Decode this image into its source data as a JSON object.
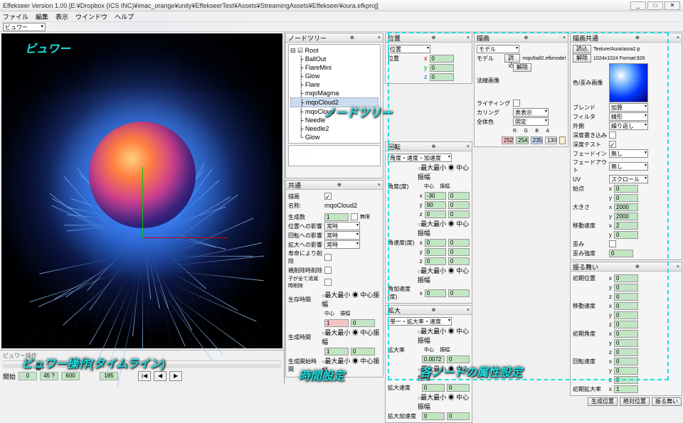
{
  "title": "Effekseer Version 1.00 [E:¥Dropbox (ICS INC)¥imac_orange¥unity¥EffekseerTest¥Assets¥StreamingAssets¥Effekseer¥oura.efkproj]",
  "menu": [
    "ファイル",
    "編集",
    "表示",
    "ウインドウ",
    "ヘルプ"
  ],
  "viewerCombo": "ビュワー",
  "ctrlHdr": "ビュワー操作",
  "playback": {
    "start": "開始",
    "v1": "0",
    "v2": "45 ?",
    "v3": "600",
    "v4": "185"
  },
  "tree": {
    "hdr": "ノードツリー",
    "root": "Root",
    "items": [
      "BallOut",
      "FlareMini",
      "Glow",
      "Flare",
      "mqoMagma",
      "mqoCloud2",
      "mqoCloud",
      "Needle",
      "Needle2",
      "Glow"
    ],
    "sel": 5
  },
  "common": {
    "hdr": "共通",
    "draw": "描画",
    "name": "名称:",
    "nameV": "mqoCloud2",
    "gen": "生成数",
    "genV": "1",
    "inf": "無限",
    "posInf": "位置への影響",
    "rotInf": "回転への影響",
    "sclInf": "拡大への影響",
    "opt": "常時",
    "life": "寿命により削除",
    "genTime": "親削除時削除",
    "allGen": "子が全て消滅時削除",
    "lifeL": "生存時間",
    "genT": "生成時間",
    "genStart": "生成開始時間",
    "mmc": "最大最小 ◉ 中心振幅",
    "center": "中心",
    "amp": "振幅"
  },
  "pos": {
    "hdr": "位置",
    "loc": "位置",
    "x": "x",
    "y": "y",
    "z": "z"
  },
  "rot": {
    "hdr": "回転",
    "mode": "角度・速度・加速度",
    "ang": "角度(度)",
    "angV": "角速度(度)",
    "angA": "角加速度(度)",
    "v30": "-30",
    "v90": "90"
  },
  "scl": {
    "hdr": "拡大",
    "mode": "単一・拡大率・速度",
    "rate": "拡大率",
    "vel": "拡大速度",
    "acc": "拡大加速度",
    "v": "0.0072"
  },
  "drawP": {
    "hdr": "描画",
    "model": "モデル",
    "load": "読込",
    "path": "mqo/ball2.efkmodel",
    "rel": "解除",
    "normal": "法線画像",
    "light": "ライティング",
    "cull": "カリング",
    "cullV": "表表示",
    "allCol": "全体色",
    "allColV": "固定",
    "rgba": [
      "R",
      "G",
      "B",
      "A"
    ],
    "rv": "252",
    "gv": "254",
    "bv": "235",
    "av": "130"
  },
  "drawC": {
    "hdr": "描画共通",
    "tex": "Texture/Aura/aura2.p",
    "texD": "1024x1024 Format:926",
    "colImg": "色/歪み画像",
    "blend": "ブレンド",
    "blendV": "加算",
    "filter": "フィルタ",
    "filterV": "線形",
    "wrap": "外側",
    "wrapV": "繰り返し",
    "depthW": "深度書き込み",
    "depthT": "深度テスト",
    "fadeIn": "フェードイン",
    "fadeOut": "フェードアウト",
    "none": "無し",
    "uv": "UV",
    "uvV": "スクロール",
    "start": "始点",
    "size": "大きさ",
    "sizeV": "2000",
    "speed": "移動速度",
    "dist": "歪み",
    "distS": "歪み強度"
  },
  "behav": {
    "hdr": "振る舞い",
    "initPos": "初期位置",
    "moveSpd": "移動速度",
    "initAng": "初期角度",
    "rotSpd": "回転速度",
    "initScl": "初期拡大率"
  },
  "footer": [
    "生成位置",
    "絶対位置",
    "振る舞い"
  ],
  "ann": {
    "viewer": "ビュワー",
    "tree": "ノードツリー",
    "timeline": "ビュワー操作(タイムライン)",
    "time": "時間設定",
    "node": "各ノードの属性設定"
  }
}
